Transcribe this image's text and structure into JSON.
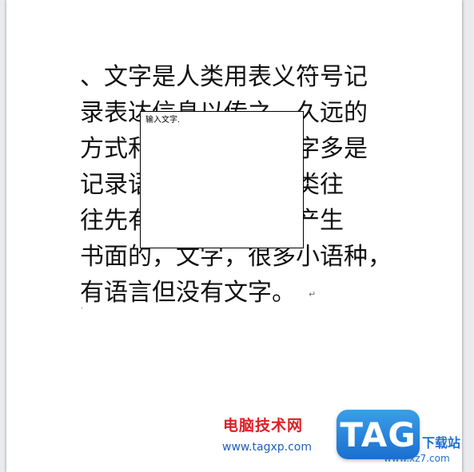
{
  "document": {
    "lines": [
      "、文字是人类用表义符号记",
      "录表达信息以传之，久远的",
      "方式和工具。现代文字多是",
      "记录语言的工具。人类往",
      "往先有口头的语言后产生",
      "书面的，文字，很多小语种，",
      "有语言但没有文字。"
    ],
    "paragraph_mark": "↵",
    "empty_paragraph_mark": "'"
  },
  "text_box": {
    "content": "输入文字."
  },
  "watermark": {
    "site_name_cn": "电脑技术网",
    "site_url": "www.tagxp.com",
    "logo_text": "TAG",
    "download_text": "下载站",
    "download_url": "www.xz7.com",
    "colors": {
      "site_name": "#dd1f26",
      "url": "#1f5fb8",
      "logo_bg": "#1a6fcf"
    }
  }
}
